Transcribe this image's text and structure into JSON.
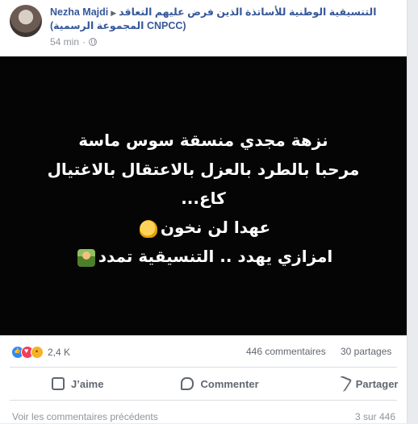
{
  "post": {
    "author": "Nezha Majdi",
    "group": "التنسيقية الوطنية للأساتذة الذين فرض عليهم التعاقد (المجموعة الرسمية CNPCC)",
    "time": "54 min",
    "dot": "·",
    "image_lines": [
      "نزهة مجدي منسقة سوس ماسة",
      "مرحبا بالطرد بالعزل بالاعتقال بالاغتيال",
      "كاع...",
      "عهدا لن نخون",
      "امزازي يهدد .. التنسيقية تمدد"
    ]
  },
  "stats": {
    "reactions": "2,4 K",
    "comments": "446 commentaires",
    "shares": "30 partages"
  },
  "actions": {
    "like": "J’aime",
    "comment": "Commenter",
    "share": "Partager"
  },
  "footer": {
    "previous": "Voir les commentaires précédents",
    "count": "3 sur 446"
  },
  "icons": {
    "globe": "globe-icon",
    "fist": "raised-fist-icon",
    "teacher": "teacher-icon"
  },
  "colors": {
    "link": "#365899",
    "meta": "#90949c",
    "image_bg": "#050505"
  }
}
